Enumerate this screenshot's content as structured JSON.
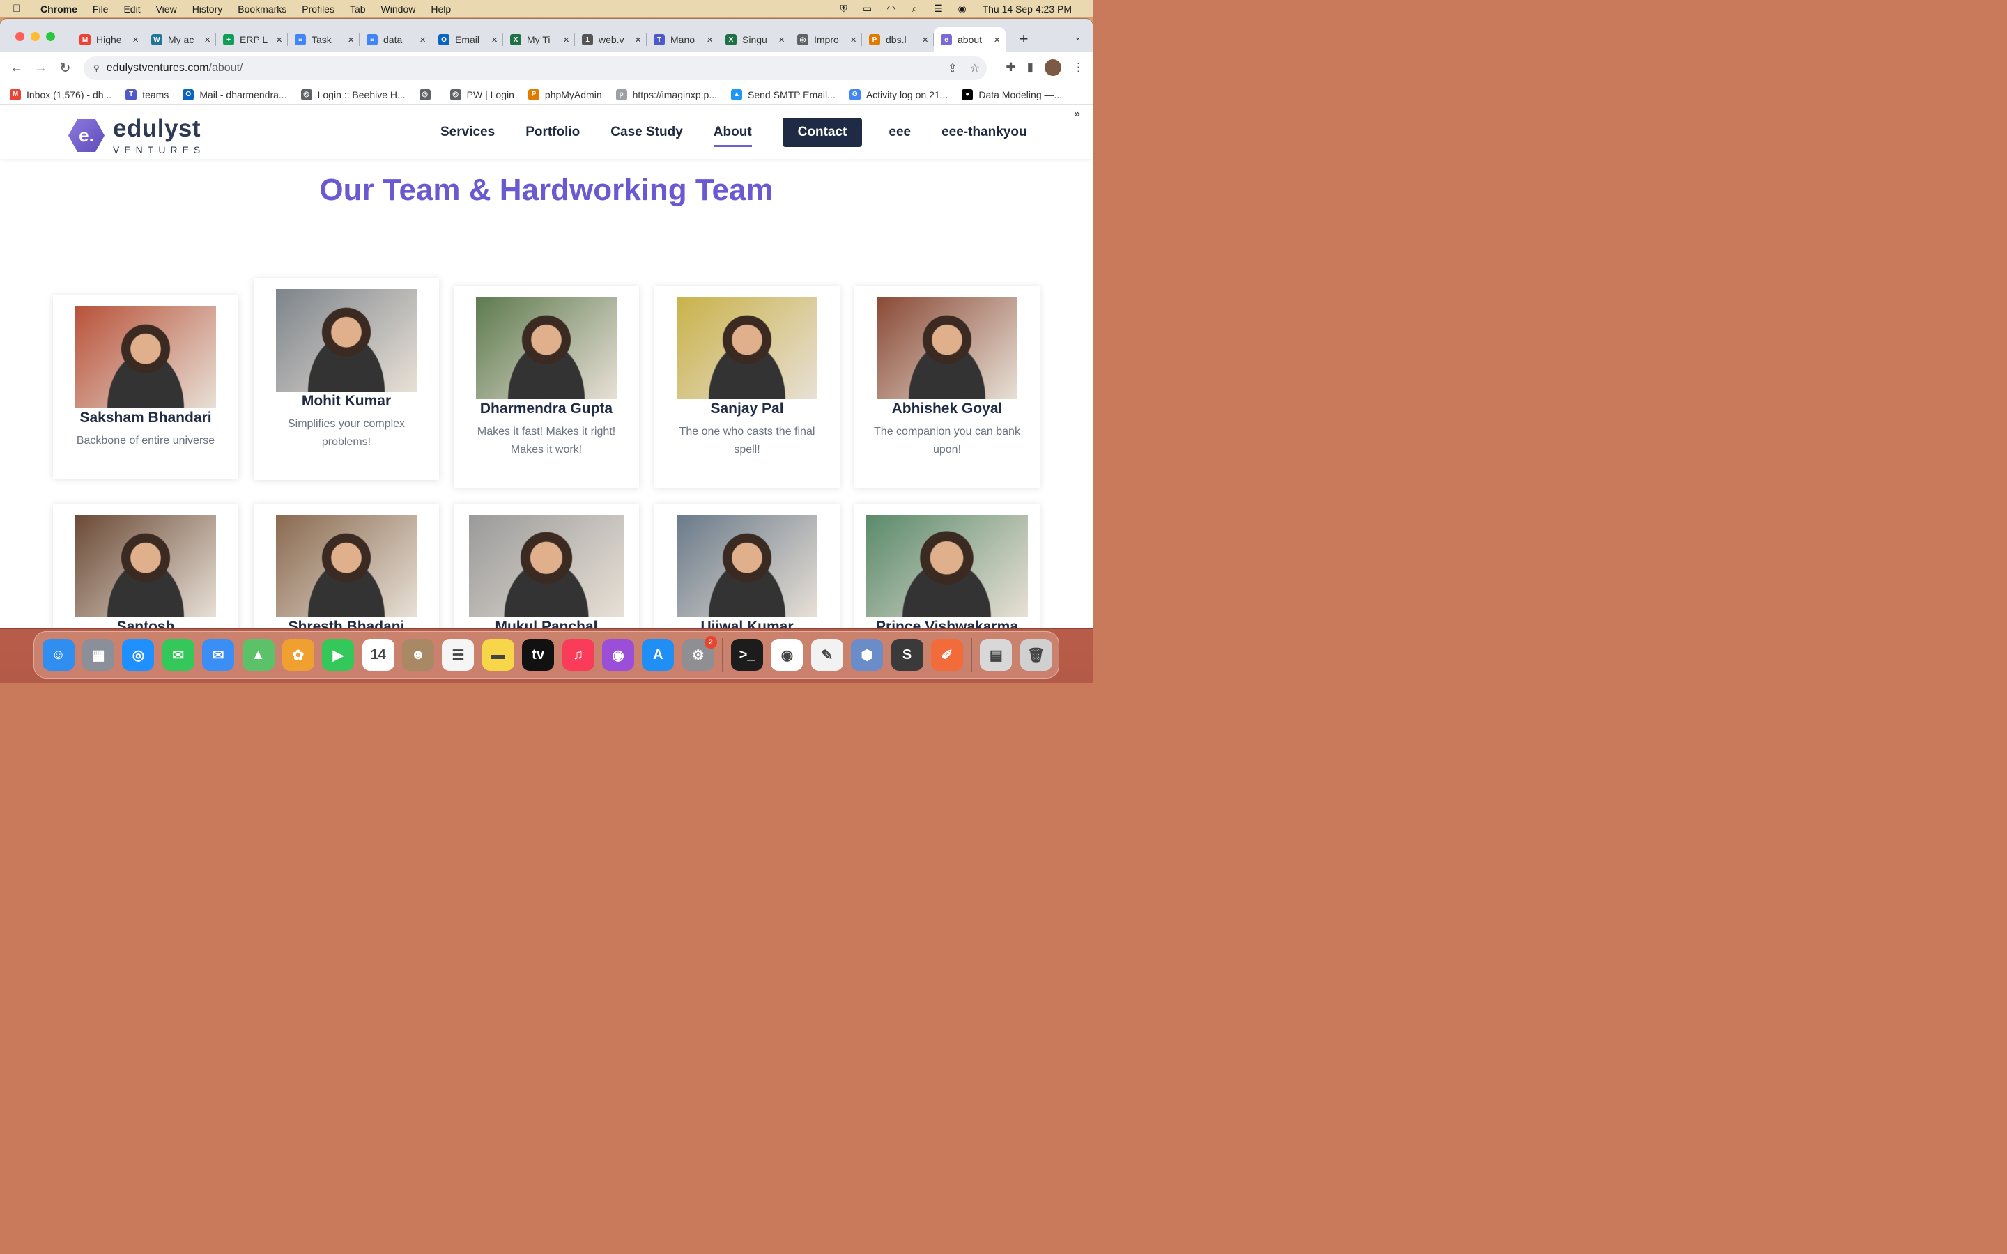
{
  "menubar": {
    "app": "Chrome",
    "items": [
      "File",
      "Edit",
      "View",
      "History",
      "Bookmarks",
      "Profiles",
      "Tab",
      "Window",
      "Help"
    ],
    "clock": "Thu 14 Sep  4:23 PM"
  },
  "tabs": [
    {
      "title": "Highe",
      "fav": "M",
      "color": "#ea4335"
    },
    {
      "title": "My ac",
      "fav": "W",
      "color": "#21759b"
    },
    {
      "title": "ERP L",
      "fav": "+",
      "color": "#0f9d58"
    },
    {
      "title": "Task",
      "fav": "≡",
      "color": "#4285f4"
    },
    {
      "title": "data",
      "fav": "≡",
      "color": "#4285f4"
    },
    {
      "title": "Email",
      "fav": "O",
      "color": "#0a64c2"
    },
    {
      "title": "My Ti",
      "fav": "X",
      "color": "#1e7145"
    },
    {
      "title": "web.v",
      "fav": "1",
      "color": "#555555"
    },
    {
      "title": "Mano",
      "fav": "T",
      "color": "#5059c9"
    },
    {
      "title": "Singu",
      "fav": "X",
      "color": "#1e7145"
    },
    {
      "title": "Impro",
      "fav": "◎",
      "color": "#5f6368"
    },
    {
      "title": "dbs.l",
      "fav": "P",
      "color": "#e07b00"
    },
    {
      "title": "about",
      "fav": "e",
      "color": "#7a6ad8",
      "active": true
    }
  ],
  "address": {
    "domain": "edulystventures.com",
    "path": "/about/"
  },
  "bookmarks": [
    {
      "label": "Inbox (1,576) - dh...",
      "color": "#ea4335",
      "fav": "M"
    },
    {
      "label": "teams",
      "color": "#5059c9",
      "fav": "T"
    },
    {
      "label": "Mail - dharmendra...",
      "color": "#0a64c2",
      "fav": "O"
    },
    {
      "label": "Login :: Beehive H...",
      "color": "#5f6368",
      "fav": "◎"
    },
    {
      "label": "",
      "color": "#5f6368",
      "fav": "◎"
    },
    {
      "label": "PW | Login",
      "color": "#5f6368",
      "fav": "◎"
    },
    {
      "label": "phpMyAdmin",
      "color": "#e07b00",
      "fav": "P"
    },
    {
      "label": "https://imaginxp.p...",
      "color": "#9aa0a6",
      "fav": "p"
    },
    {
      "label": "Send SMTP Email...",
      "color": "#2196f3",
      "fav": "▲"
    },
    {
      "label": "Activity log on 21...",
      "color": "#4285f4",
      "fav": "G"
    },
    {
      "label": "Data Modeling —...",
      "color": "#000000",
      "fav": "●"
    }
  ],
  "site": {
    "logo_main": "edulyst",
    "logo_sub": "VENTURES",
    "nav": [
      "Services",
      "Portfolio",
      "Case Study",
      "About"
    ],
    "contact": "Contact",
    "extra": [
      "eee",
      "eee-thankyou"
    ],
    "headline": "Our Team & Hardworking Team"
  },
  "team": [
    {
      "name": "Saksham Bhandari",
      "role": "Backbone of entire universe",
      "tint": "#b8523a"
    },
    {
      "name": "Mohit Kumar",
      "role": "Simplifies your complex problems!",
      "tint": "#7d848b"
    },
    {
      "name": "Dharmendra Gupta",
      "role": "Makes it fast! Makes it right! Makes it work!",
      "tint": "#5d7a4e"
    },
    {
      "name": "Sanjay Pal",
      "role": "The one who casts the final spell!",
      "tint": "#c9b24a"
    },
    {
      "name": "Abhishek Goyal",
      "role": "The companion you can bank upon!",
      "tint": "#8a4a36"
    },
    {
      "name": "Santosh",
      "role": "",
      "tint": "#6b4a36"
    },
    {
      "name": "Shresth Bhadani",
      "role": "",
      "tint": "#8a6a50"
    },
    {
      "name": "Mukul Panchal",
      "role": "",
      "tint": "#9a9a9a"
    },
    {
      "name": "Ujjwal Kumar",
      "role": "",
      "tint": "#6a7a8a"
    },
    {
      "name": "Prince Vishwakarma",
      "role": "",
      "tint": "#5a8a6a"
    }
  ],
  "dock": [
    {
      "icon": "finder-icon",
      "color": "#2f8ef0",
      "glyph": "☺"
    },
    {
      "icon": "launchpad-icon",
      "color": "#8a8f99",
      "glyph": "▦"
    },
    {
      "icon": "safari-icon",
      "color": "#1e90ff",
      "glyph": "◎"
    },
    {
      "icon": "messages-icon",
      "color": "#34c759",
      "glyph": "✉"
    },
    {
      "icon": "mail-icon",
      "color": "#3b8ef5",
      "glyph": "✉"
    },
    {
      "icon": "maps-icon",
      "color": "#5bc26a",
      "glyph": "▲"
    },
    {
      "icon": "photos-icon",
      "color": "#f0a030",
      "glyph": "✿"
    },
    {
      "icon": "facetime-icon",
      "color": "#34c759",
      "glyph": "▶"
    },
    {
      "icon": "calendar-icon",
      "color": "#ffffff",
      "glyph": "14"
    },
    {
      "icon": "contacts-icon",
      "color": "#a98866",
      "glyph": "☻"
    },
    {
      "icon": "reminders-icon",
      "color": "#f5f5f5",
      "glyph": "☰"
    },
    {
      "icon": "notes-icon",
      "color": "#f7d64a",
      "glyph": "▬"
    },
    {
      "icon": "tv-icon",
      "color": "#111111",
      "glyph": "tv"
    },
    {
      "icon": "music-icon",
      "color": "#fa3c5a",
      "glyph": "♫"
    },
    {
      "icon": "podcasts-icon",
      "color": "#9b4fd9",
      "glyph": "◉"
    },
    {
      "icon": "appstore-icon",
      "color": "#1f8ef5",
      "glyph": "A"
    },
    {
      "icon": "settings-icon",
      "color": "#8e8e93",
      "glyph": "⚙",
      "badge": "2"
    },
    {
      "icon": "terminal-icon",
      "color": "#1c1c1c",
      "glyph": ">_",
      "sep": true
    },
    {
      "icon": "chrome-icon",
      "color": "#ffffff",
      "glyph": "◉"
    },
    {
      "icon": "textedit-icon",
      "color": "#f2f2f2",
      "glyph": "✎"
    },
    {
      "icon": "box-icon",
      "color": "#6a8cc8",
      "glyph": "⬢"
    },
    {
      "icon": "sublime-icon",
      "color": "#3a3a3a",
      "glyph": "S"
    },
    {
      "icon": "postman-icon",
      "color": "#f26b3a",
      "glyph": "✐"
    },
    {
      "icon": "documents-icon",
      "color": "#d8d8d8",
      "glyph": "▤",
      "sep": true
    },
    {
      "icon": "trash-icon",
      "color": "#d0d0d0",
      "glyph": "🗑"
    }
  ]
}
